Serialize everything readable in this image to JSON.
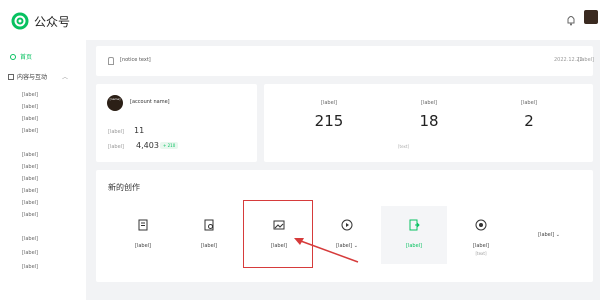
{
  "header": {
    "brand": "公众号",
    "brand_color": "#07c160",
    "icons": [
      "wechat-logo-icon",
      "bell-icon",
      "avatar"
    ]
  },
  "sidebar": {
    "home": "首页",
    "group": "内容与互动",
    "items": [
      "[label]",
      "[label]",
      "[label]",
      "[label]",
      "[label]",
      "[label]",
      "[label]",
      "[label]",
      "[label]",
      "[label]",
      "[label]",
      "[label]",
      "[label]"
    ]
  },
  "notice": {
    "text": "[notice text]",
    "date": "2022.12.22",
    "more": "[label]"
  },
  "account": {
    "avatar_text": "[name]",
    "name": "[account name]",
    "stat1_label": "[label]",
    "stat1_value": "11",
    "stat2_label": "[label]",
    "stat2_value": "4,403",
    "stat2_badge": "+ 210"
  },
  "stats": {
    "items": [
      {
        "label": "[label]",
        "value": "215"
      },
      {
        "label": "[label]",
        "value": "18"
      },
      {
        "label": "[label]",
        "value": "2"
      }
    ],
    "sub": "[text]"
  },
  "create": {
    "title": "新的创作",
    "cards": [
      {
        "label": "[label]",
        "icon": "article-icon"
      },
      {
        "label": "[label]",
        "icon": "select-article-icon"
      },
      {
        "label": "[label]",
        "icon": "image-icon"
      },
      {
        "label": "[label] ⌄",
        "icon": "video-icon"
      },
      {
        "label": "[label]",
        "icon": "transfer-icon"
      },
      {
        "label": "[label]",
        "sub": "[text]",
        "icon": "record-icon"
      },
      {
        "label": "[label] ⌄",
        "icon": "more-icon"
      }
    ],
    "highlight_color": "#d63b3b"
  }
}
